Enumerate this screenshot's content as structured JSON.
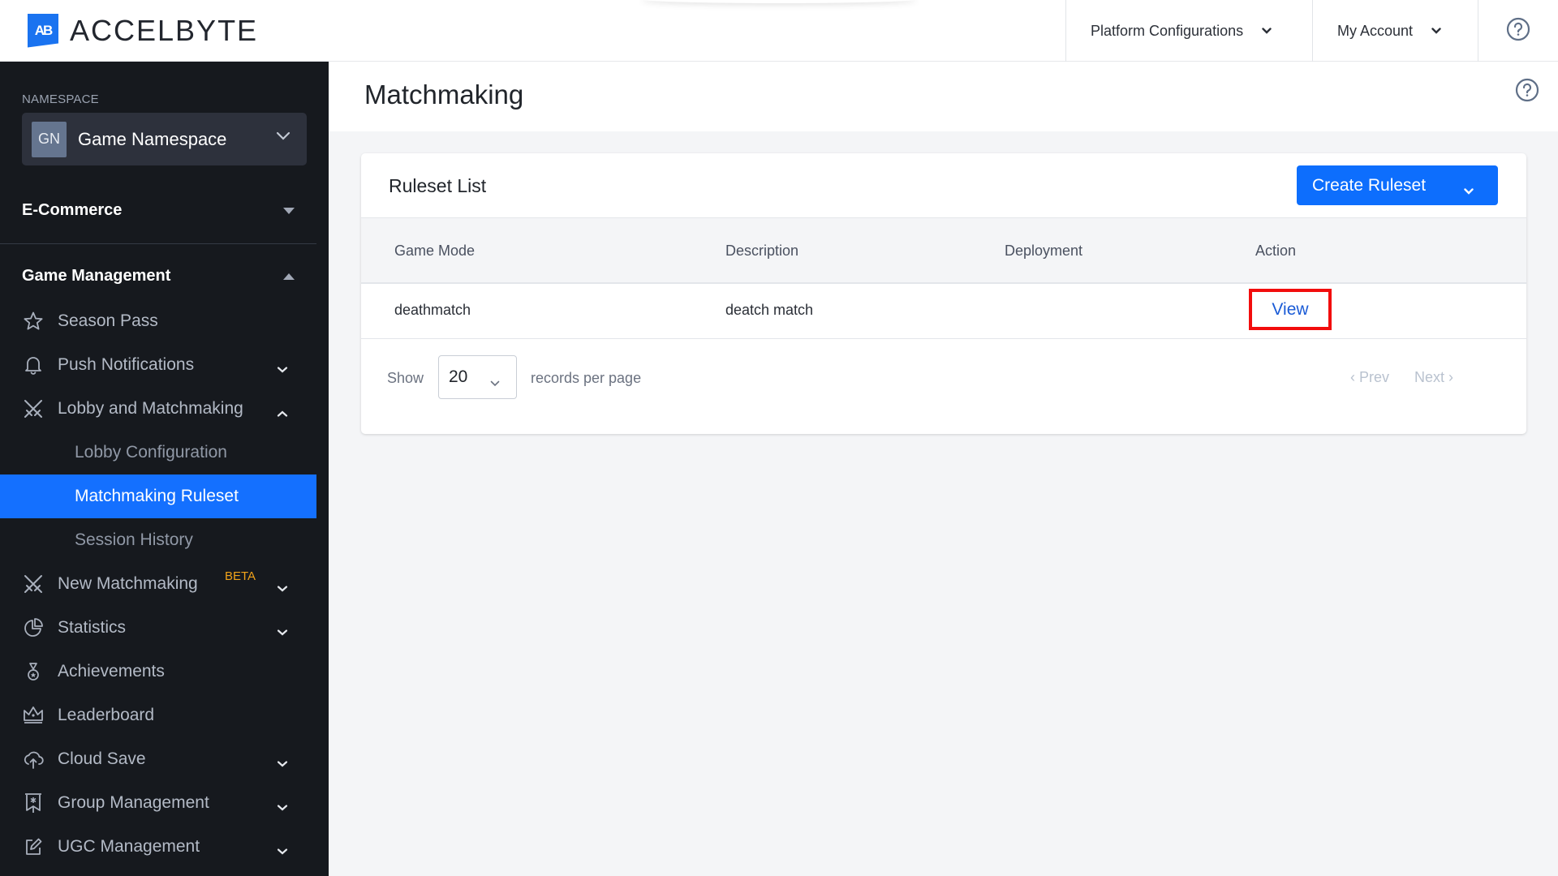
{
  "header": {
    "logo_text": "ACCELBYTE",
    "logo_mark": "AB",
    "nav": [
      {
        "label": "Platform Configurations",
        "icon": "chevron-down-icon"
      },
      {
        "label": "My Account",
        "icon": "chevron-down-icon"
      }
    ],
    "help_icon": "help-circle-icon"
  },
  "sidebar": {
    "namespace_label": "NAMESPACE",
    "namespace": {
      "initials": "GN",
      "name": "Game Namespace"
    },
    "sections": [
      {
        "label": "E-Commerce",
        "expanded": false
      },
      {
        "label": "Game Management",
        "expanded": true
      }
    ],
    "items": [
      {
        "label": "Season Pass",
        "icon": "star-icon",
        "chevron": null
      },
      {
        "label": "Push Notifications",
        "icon": "bell-icon",
        "chevron": "down"
      },
      {
        "label": "Lobby and Matchmaking",
        "icon": "crossed-swords-icon",
        "chevron": "up"
      },
      {
        "label": "New Matchmaking",
        "icon": "crossed-swords-icon",
        "chevron": "down",
        "badge": "BETA"
      },
      {
        "label": "Statistics",
        "icon": "pie-chart-icon",
        "chevron": "down"
      },
      {
        "label": "Achievements",
        "icon": "medal-icon",
        "chevron": null
      },
      {
        "label": "Leaderboard",
        "icon": "crown-icon",
        "chevron": null
      },
      {
        "label": "Cloud Save",
        "icon": "cloud-upload-icon",
        "chevron": "down"
      },
      {
        "label": "Group Management",
        "icon": "group-banner-icon",
        "chevron": "down"
      },
      {
        "label": "UGC Management",
        "icon": "edit-icon",
        "chevron": "down"
      }
    ],
    "sub_items": [
      {
        "label": "Lobby Configuration",
        "active": false
      },
      {
        "label": "Matchmaking Ruleset",
        "active": true
      },
      {
        "label": "Session History",
        "active": false
      }
    ]
  },
  "main": {
    "page_title": "Matchmaking",
    "card": {
      "title": "Ruleset List",
      "create_button": "Create Ruleset",
      "columns": [
        "Game Mode",
        "Description",
        "Deployment",
        "Action"
      ],
      "rows": [
        {
          "game_mode": "deathmatch",
          "description": "deatch match",
          "deployment": "",
          "action": "View"
        }
      ],
      "pagination": {
        "show_label": "Show",
        "per_page": "20",
        "records_label": "records per page",
        "prev": "‹ Prev",
        "next": "Next ›"
      }
    }
  },
  "colors": {
    "accent": "#0d6efd",
    "sidebar_bg": "#16191e",
    "active_item": "#1470ff",
    "beta_badge": "#f0a21a",
    "highlight_box": "#f20d0d"
  }
}
